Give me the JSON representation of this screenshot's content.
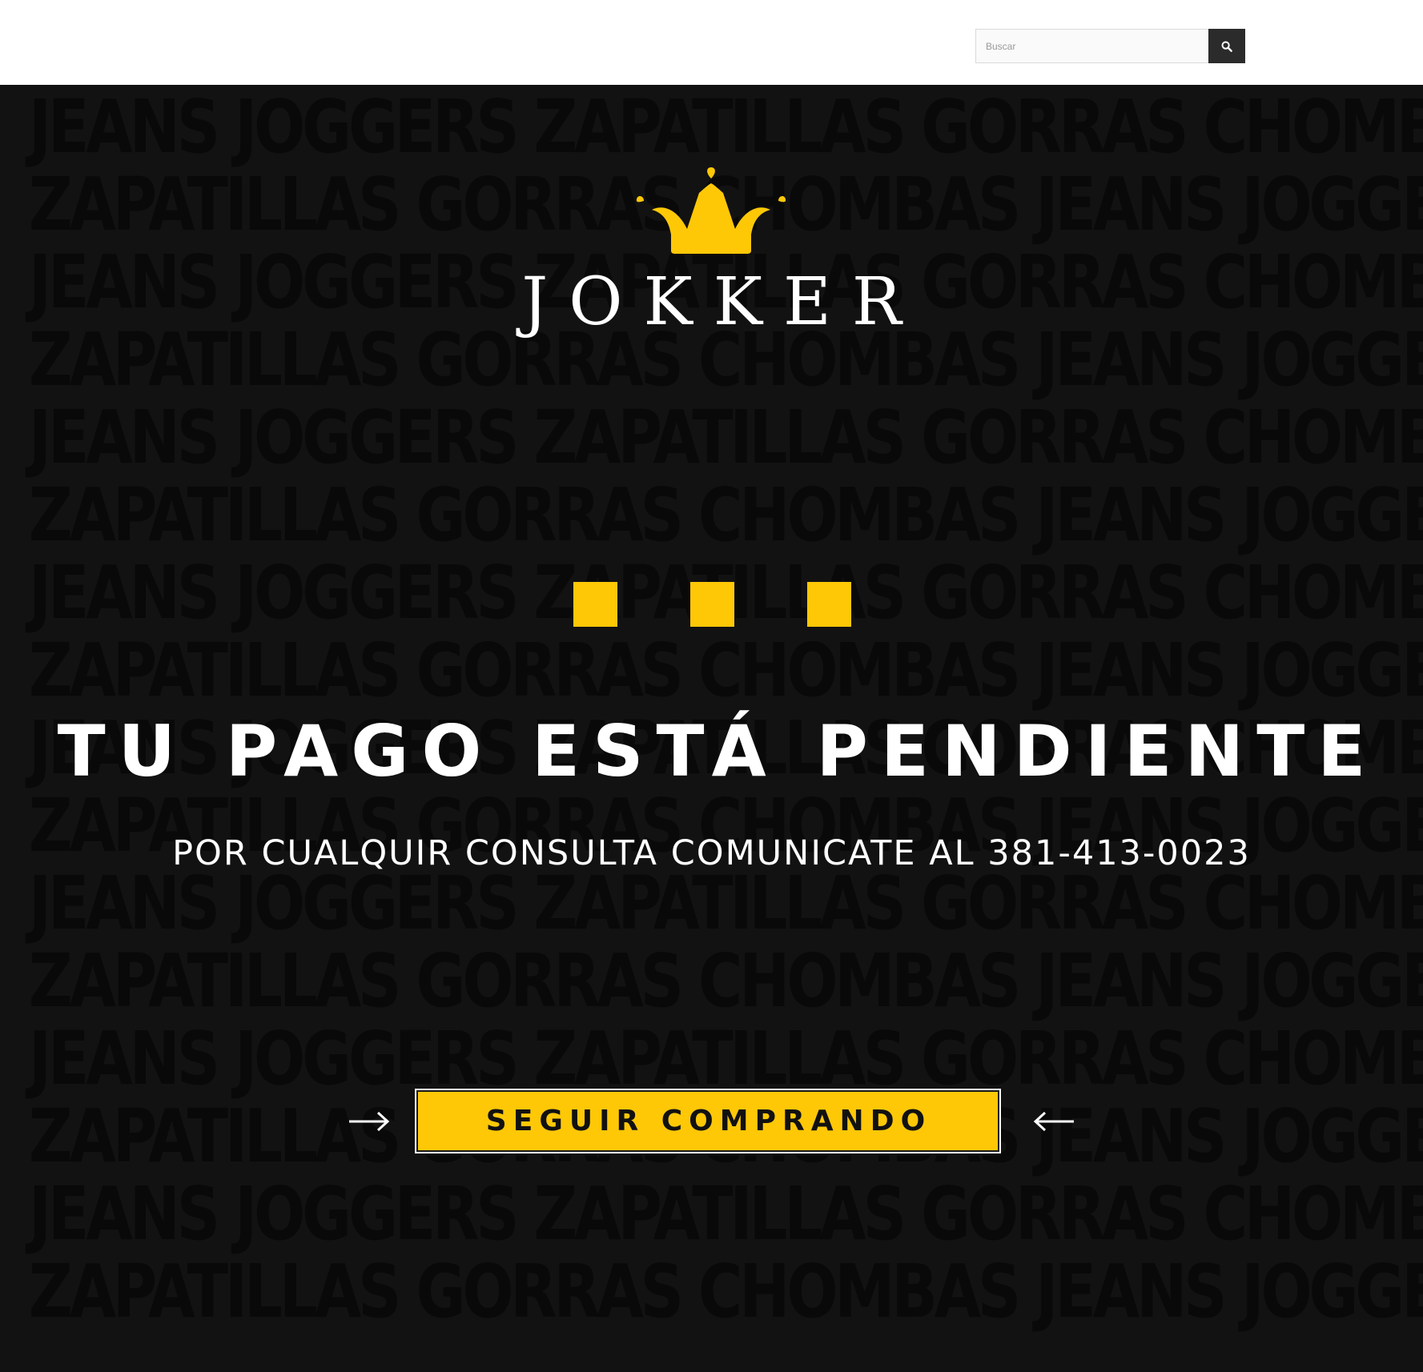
{
  "header": {
    "search": {
      "placeholder": "Buscar",
      "button_icon": "search-icon"
    }
  },
  "hero": {
    "background_color": "#121212",
    "background_words": [
      "JEANS JOGGERS ZAPATILLAS GORRAS CHOMBAS",
      "ZAPATILLAS GORRAS CHOMBAS JEANS JOGGERS"
    ],
    "logo": {
      "icon": "crown-icon",
      "wordmark": "JOKKER"
    },
    "accent_color": "#fec807",
    "headline": "TU PAGO ESTÁ PENDIENTE",
    "subline": "POR CUALQUIR CONSULTA COMUNICATE AL 381-413-0023",
    "cta": {
      "label": "SEGUIR COMPRANDO",
      "left_icon": "arrow-right-icon",
      "right_icon": "arrow-left-icon"
    }
  }
}
